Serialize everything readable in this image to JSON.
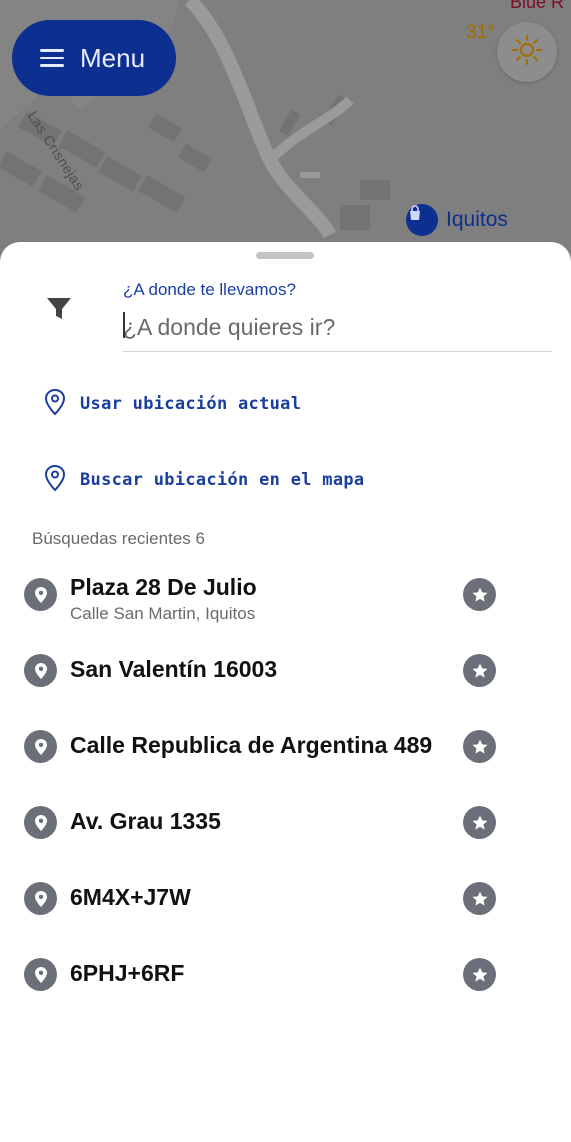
{
  "map": {
    "temperature": "31°",
    "top_partial_label": "Blue R",
    "poi_name": "Iquitos",
    "street_label": "Las Crisnejas"
  },
  "menu": {
    "label": "Menu"
  },
  "search": {
    "label": "¿A donde te llevamos?",
    "placeholder": "¿A donde quieres ir?"
  },
  "actions": [
    {
      "label": "Usar ubicación actual",
      "icon": "location-pin-outline-icon"
    },
    {
      "label": "Buscar ubicación en el mapa",
      "icon": "location-pin-outline-icon"
    }
  ],
  "recent": {
    "title": "Búsquedas recientes 6",
    "items": [
      {
        "title": "Plaza 28 De Julio",
        "subtitle": "Calle San Martin, Iquitos"
      },
      {
        "title": "San Valentín 16003"
      },
      {
        "title": "Calle Republica de Argentina 489"
      },
      {
        "title": "Av. Grau 1335"
      },
      {
        "title": "6M4X+J7W"
      },
      {
        "title": "6PHJ+6RF"
      }
    ]
  },
  "colors": {
    "brand_blue": "#0d2f8f",
    "link_blue": "#1a3e9e",
    "icon_gray": "#6b7078",
    "overlay_gray": "#7f7f7f"
  }
}
